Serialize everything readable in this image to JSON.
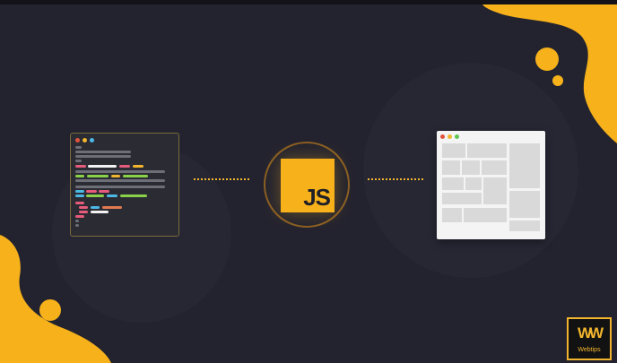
{
  "colors": {
    "background": "#23232f",
    "accent_yellow": "#f6b11b",
    "code_window_bg": "#2b2b33",
    "browser_bg": "#f4f4f4"
  },
  "code_window": {
    "traffic_lights": [
      "#e0533f",
      "#f2b52d",
      "#4cb8e6"
    ]
  },
  "browser_window": {
    "traffic_lights": [
      "#e0533f",
      "#f2b52d",
      "#61c454"
    ]
  },
  "js_badge": {
    "label": "JS"
  },
  "logo": {
    "mark": "WW",
    "text": "Webtips"
  },
  "icons": [
    "code-editor-icon",
    "javascript-icon",
    "browser-layout-icon"
  ]
}
